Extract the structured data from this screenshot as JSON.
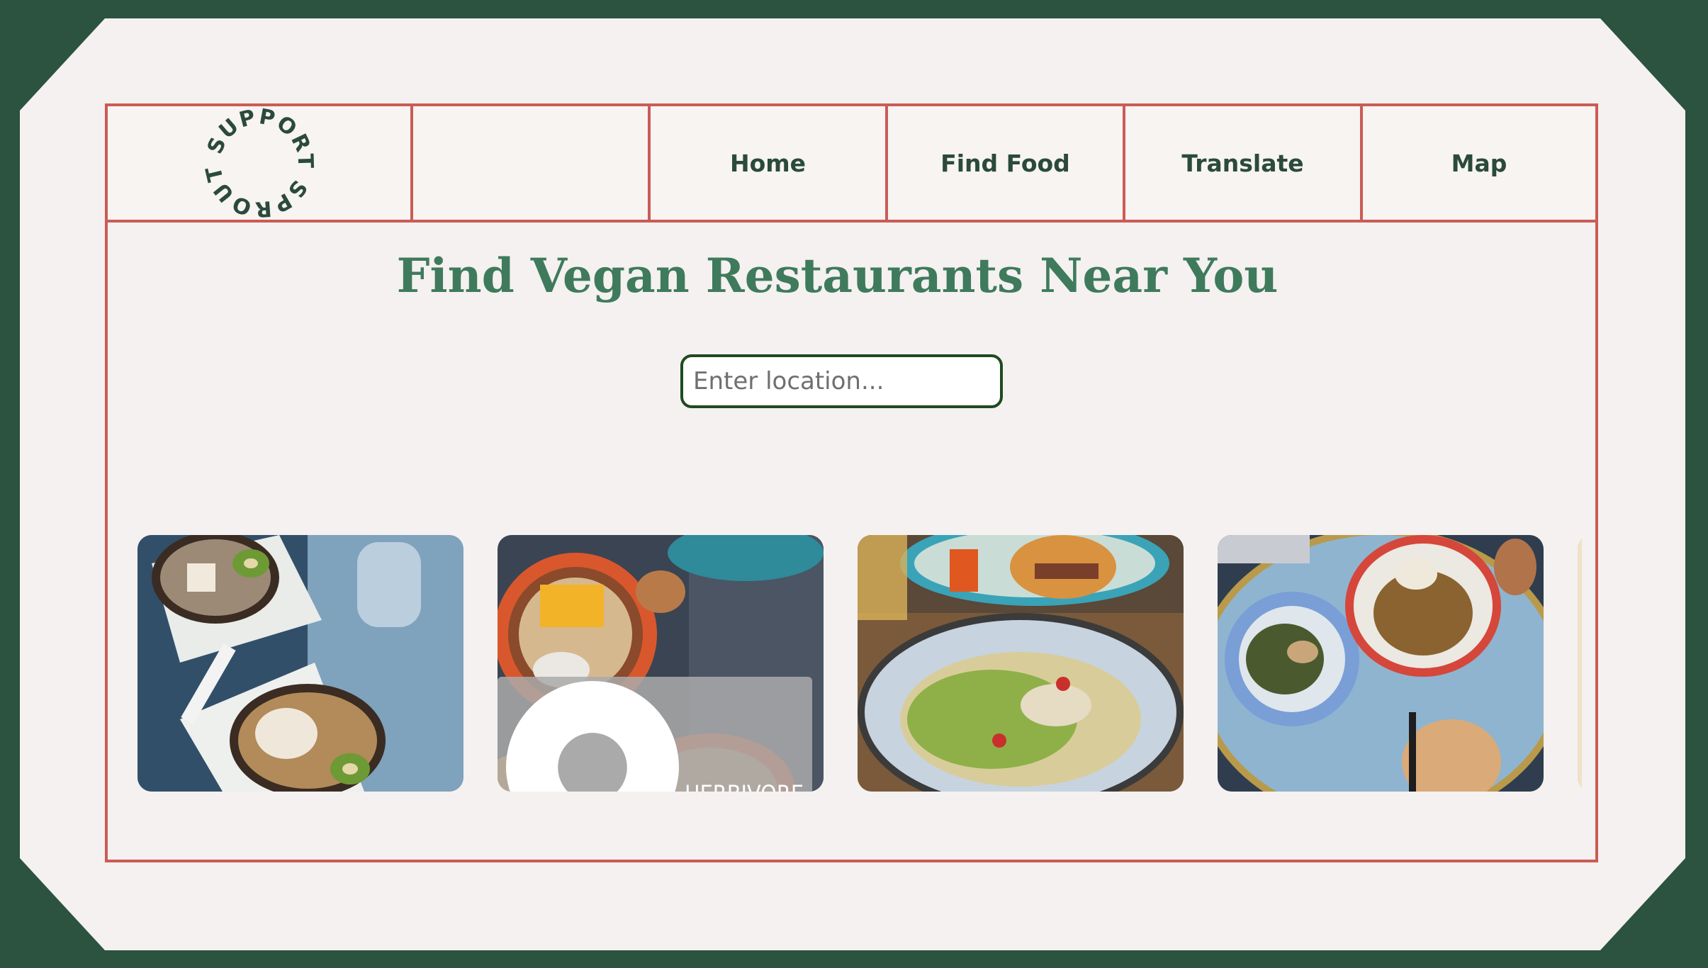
{
  "brand": {
    "logo_text": "SUPPORT SPROUT"
  },
  "nav": {
    "links": [
      {
        "label": "Home"
      },
      {
        "label": "Find Food"
      },
      {
        "label": "Translate"
      },
      {
        "label": "Map"
      }
    ]
  },
  "hero": {
    "title": "Find Vegan Restaurants Near You"
  },
  "search": {
    "placeholder": "Enter location...",
    "value": ""
  },
  "gallery": {
    "photos": [
      {
        "alt": "acai bowls with kiwi and granola"
      },
      {
        "alt": "mango granola bowl",
        "location_tag": "HERBIVORE"
      },
      {
        "alt": "salad with sprouts and burger"
      },
      {
        "alt": "sauteed greens and roasted potatoes"
      }
    ]
  },
  "colors": {
    "background": "#2c5240",
    "card": "#f4f1f0",
    "frame_border": "#cc5b55",
    "title": "#3f7a5c",
    "nav_text": "#2b4a3c",
    "search_border": "#1f4a1f"
  }
}
